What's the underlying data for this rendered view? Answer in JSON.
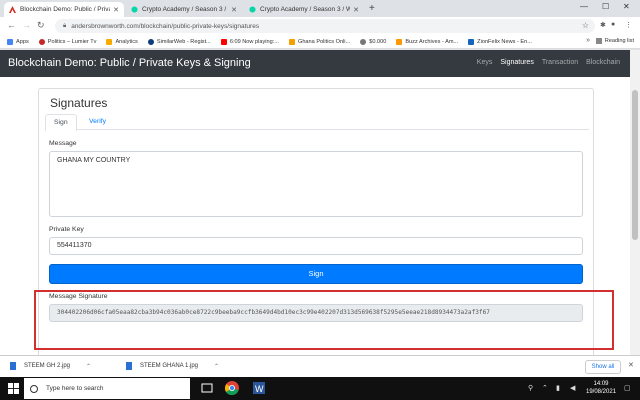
{
  "browser": {
    "tabs": [
      {
        "label": "Blockchain Demo: Public / Privat",
        "active": true
      },
      {
        "label": "Crypto Academy / Season 3 / W",
        "active": false
      },
      {
        "label": "Crypto Academy / Season 3 / W",
        "active": false
      }
    ],
    "url": "andersbrownworth.com/blockchain/public-private-keys/signatures",
    "bookmarks": [
      "Apps",
      "Politics – Lumier Tv",
      "Analytics",
      "SimilarWeb - Regist...",
      "6:09 Now playing:...",
      "Ghana Politics Onli...",
      "$0.000",
      "Buzz Archives - Am...",
      "ZionFelix News - En..."
    ],
    "reading_list": "Reading list"
  },
  "site": {
    "brand": "Blockchain Demo: Public / Private Keys & Signing",
    "nav": [
      "Keys",
      "Signatures",
      "Transaction",
      "Blockchain"
    ],
    "active_nav": "Signatures"
  },
  "card": {
    "title": "Signatures",
    "tabs": [
      "Sign",
      "Verify"
    ],
    "message_label": "Message",
    "message_value": "GHANA MY COUNTRY",
    "private_key_label": "Private Key",
    "private_key_value": "554411370",
    "sign_button": "Sign",
    "signature_label": "Message Signature",
    "signature_value": "304402206d06cfa05eaa82cba3b94c036ab0ce8722c9beeba9ccfb3649d4bd10ec3c99e402207d313d569638f5295e5eeae218d8934473a2af3f67"
  },
  "downloads": {
    "items": [
      "STEEM GH 2.jpg",
      "STEEM GHANA 1.jpg"
    ],
    "show_all": "Show all"
  },
  "taskbar": {
    "search_placeholder": "Type here to search",
    "time": "14:09",
    "date": "19/08/2021"
  },
  "colors": {
    "accent": "#007bff",
    "navbar": "#343a40",
    "highlight": "#d32f2f"
  }
}
